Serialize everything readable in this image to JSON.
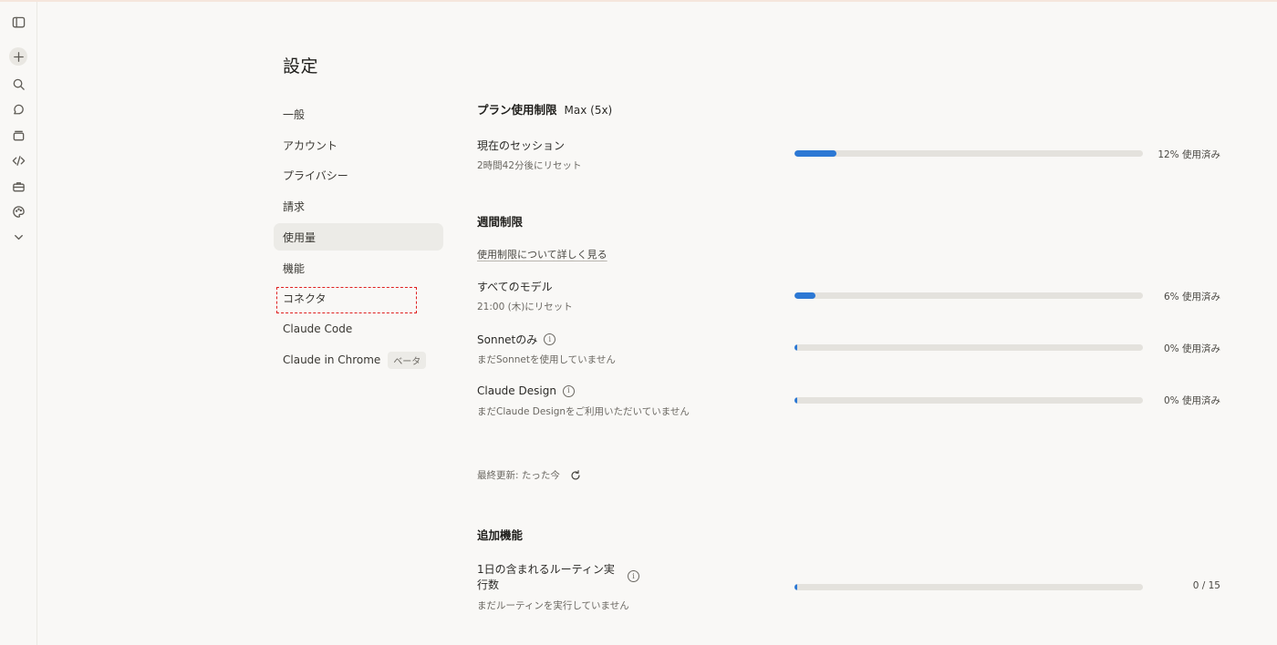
{
  "sidebar_rail": {
    "icons": [
      "sidebar-toggle-icon",
      "new-chat-icon",
      "search-icon",
      "chat-icon",
      "projects-icon",
      "code-icon",
      "toolbox-icon",
      "palette-icon",
      "chevron-down-icon"
    ]
  },
  "page": {
    "title": "設定"
  },
  "nav": {
    "items": [
      {
        "label": "一般"
      },
      {
        "label": "アカウント"
      },
      {
        "label": "プライバシー"
      },
      {
        "label": "請求"
      },
      {
        "label": "使用量",
        "active": true
      },
      {
        "label": "機能"
      },
      {
        "label": "コネクタ"
      },
      {
        "label": "Claude Code"
      },
      {
        "label": "Claude in Chrome",
        "badge": "ベータ"
      }
    ]
  },
  "plan": {
    "title": "プラン使用制限",
    "tier": "Max (5x)",
    "session": {
      "label": "現在のセッション",
      "sub": "2時間42分後にリセット",
      "percent": 12,
      "pct_text": "12% 使用済み"
    }
  },
  "weekly": {
    "title": "週間制限",
    "link": "使用制限について詳しく見る",
    "rows": [
      {
        "label": "すべてのモデル",
        "sub": "21:00 (木)にリセット",
        "percent": 6,
        "pct_text": "6% 使用済み",
        "info": false
      },
      {
        "label": "Sonnetのみ",
        "sub": "まだSonnetを使用していません",
        "percent": 0,
        "pct_text": "0% 使用済み",
        "info": true
      },
      {
        "label": "Claude Design",
        "sub": "まだClaude Designをご利用いただいていません",
        "percent": 0,
        "pct_text": "0% 使用済み",
        "info": true
      }
    ],
    "last_updated": "最終更新: たった今"
  },
  "extra": {
    "title": "追加機能",
    "routine": {
      "label_line1": "1日の含まれるルーティン実",
      "label_line2": "行数",
      "sub": "まだルーティンを実行していません",
      "used": 0,
      "total": 15,
      "count_text": "0 / 15"
    }
  },
  "colors": {
    "accent": "#2c78d4",
    "track": "#e4e2dd",
    "highlight": "#e02020"
  }
}
